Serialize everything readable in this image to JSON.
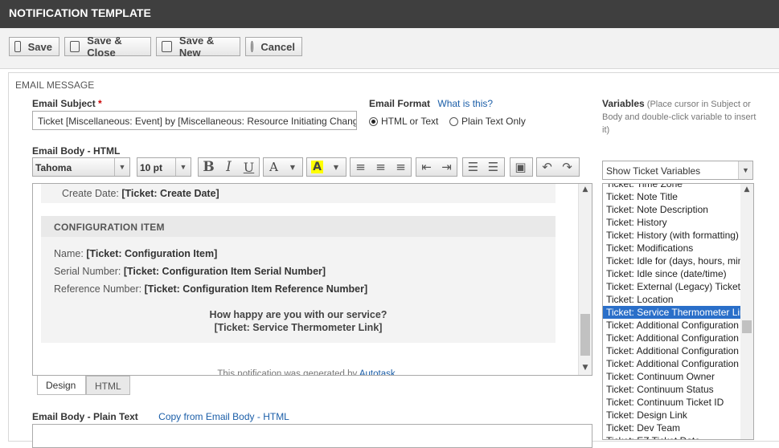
{
  "window": {
    "title": "NOTIFICATION TEMPLATE"
  },
  "toolbar": {
    "save": "Save",
    "save_close": "Save & Close",
    "save_new": "Save & New",
    "cancel": "Cancel"
  },
  "section": {
    "title": "EMAIL MESSAGE"
  },
  "subject": {
    "label": "Email Subject",
    "required_mark": "*",
    "value": "Ticket [Miscellaneous: Event] by [Miscellaneous: Resource Initiating Chang"
  },
  "format": {
    "label": "Email Format",
    "help_link": "What is this?",
    "option_html": "HTML or Text",
    "option_plain": "Plain Text Only",
    "selected": "HTML or Text"
  },
  "variables": {
    "label": "Variables",
    "hint": "(Place cursor in Subject or Body and double-click variable to insert it)",
    "select_value": "Show Ticket Variables",
    "items": [
      "Ticket: Time Zone",
      "Ticket: Note Title",
      "Ticket: Note Description",
      "Ticket: History",
      "Ticket: History (with formatting)",
      "Ticket: Modifications",
      "Ticket: Idle for (days, hours, minutes)",
      "Ticket: Idle since (date/time)",
      "Ticket: External (Legacy) Ticket ID",
      "Ticket: Location",
      "Ticket: Service Thermometer Link",
      "Ticket: Additional Configuration Item",
      "Ticket: Additional Configuration Item",
      "Ticket: Additional Configuration Item",
      "Ticket: Additional Configuration Item",
      "Ticket: Continuum Owner",
      "Ticket: Continuum Status",
      "Ticket: Continuum Ticket ID",
      "Ticket: Design Link",
      "Ticket: Dev Team",
      "Ticket: EZ Ticket Date"
    ],
    "selected_index": 10
  },
  "body_html": {
    "label": "Email Body - HTML",
    "font": "Tahoma",
    "size": "10 pt",
    "content": {
      "create_date_label": "Create Date:",
      "create_date_var": "[Ticket: Create Date]",
      "ci_header": "CONFIGURATION ITEM",
      "name_label": "Name:",
      "name_var": "[Ticket: Configuration Item]",
      "serial_label": "Serial Number:",
      "serial_var": "[Ticket: Configuration Item Serial Number]",
      "ref_label": "Reference Number:",
      "ref_var": "[Ticket: Configuration Item Reference Number]",
      "happy_question": "How happy are you with our service?",
      "thermometer_var": "[Ticket: Service Thermometer Link]",
      "footer_prefix": "This notification was generated by",
      "footer_link": "Autotask"
    },
    "tabs": [
      "Design",
      "HTML"
    ]
  },
  "body_plain": {
    "label": "Email Body - Plain Text",
    "copy_link": "Copy from Email Body - HTML"
  }
}
